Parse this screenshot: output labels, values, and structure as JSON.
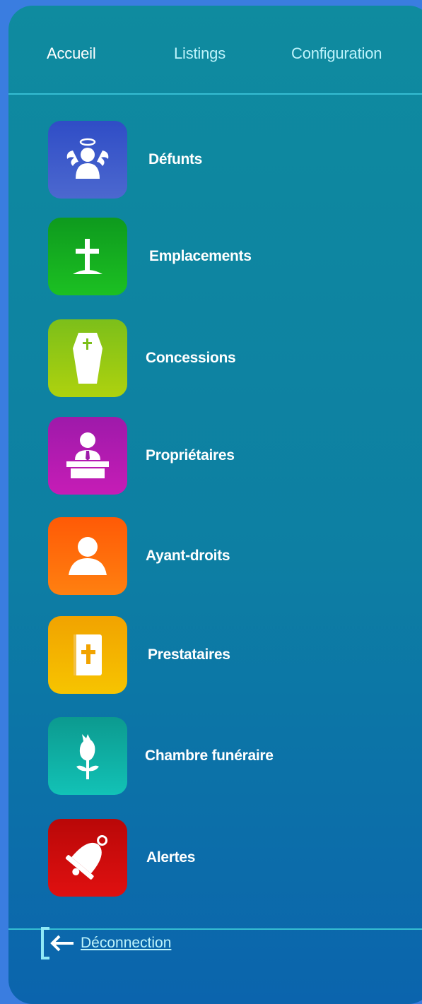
{
  "nav": {
    "tabs": [
      {
        "label": "Accueil",
        "active": true
      },
      {
        "label": "Listings",
        "active": false
      },
      {
        "label": "Configuration",
        "active": false
      }
    ]
  },
  "menu": {
    "items": [
      {
        "label": "Défunts",
        "icon": "angel-icon",
        "color": "#3a55c8"
      },
      {
        "label": "Emplacements",
        "icon": "grave-cross-icon",
        "color": "#16b01e"
      },
      {
        "label": "Concessions",
        "icon": "coffin-icon",
        "color": "#9fcc18"
      },
      {
        "label": "Propriétaires",
        "icon": "person-at-podium-icon",
        "color": "#b01ab8"
      },
      {
        "label": "Ayant-droits",
        "icon": "person-icon",
        "color": "#ff6a0a"
      },
      {
        "label": "Prestataires",
        "icon": "bible-icon",
        "color": "#f4b000"
      },
      {
        "label": "Chambre funéraire",
        "icon": "flower-icon",
        "color": "#10b7ae"
      },
      {
        "label": "Alertes",
        "icon": "bell-icon",
        "color": "#d40c0c"
      }
    ]
  },
  "footer": {
    "logout_label": "Déconnection",
    "logout_icon": "logout-icon"
  },
  "colors": {
    "panel_top": "#0f8b9f",
    "panel_bottom": "#0b64ad",
    "background": "#3a7de0",
    "accent_text": "#bdf3fb",
    "divider": "#35bdd2"
  }
}
